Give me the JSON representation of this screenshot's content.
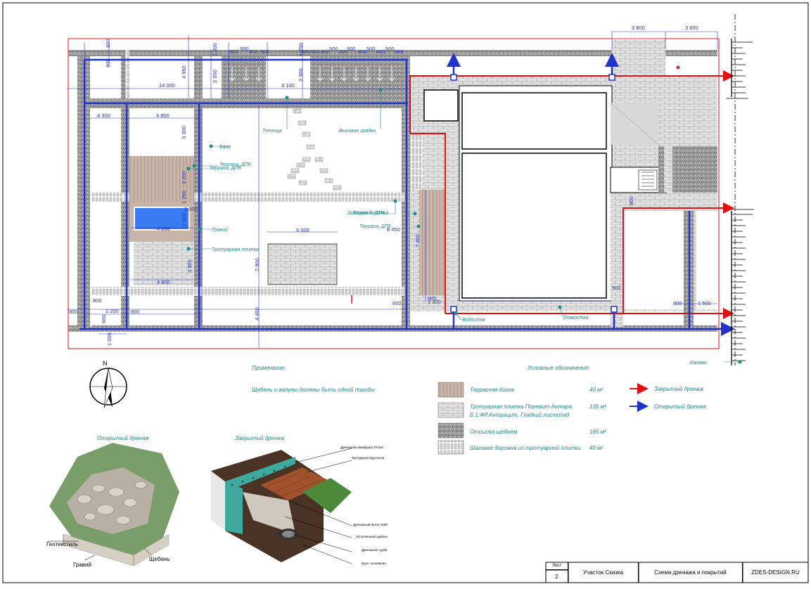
{
  "dims": {
    "top": [
      "3 800",
      "3 600",
      "800",
      "800",
      "500",
      "800",
      "500",
      "800",
      "800",
      "500",
      "800",
      "500",
      "800",
      "500",
      "800",
      "800",
      "500",
      "800",
      "800"
    ],
    "middle": [
      "14 000",
      "2 500",
      "3 100",
      "2 300",
      "4 950",
      "1 200",
      "1 250",
      "4 300",
      "4 800",
      "3 300",
      "3 200",
      "2 000",
      "1 200",
      "4 000",
      "2 000",
      "5 000",
      "2 800",
      "3 800",
      "4 800",
      "8 450",
      "7 400",
      "900",
      "800"
    ],
    "bottom": [
      "800",
      "800",
      "2 200",
      "600",
      "600",
      "1 000",
      "4 450",
      "600",
      "3 300",
      "900",
      "800",
      "1 500"
    ]
  },
  "labels": {
    "teplitsa": "Теплица",
    "vysokie_gryadki": "Высокие грядки",
    "bania": "Баня",
    "terrasa_dpk_1": "Терраса, ДПК",
    "terrasa_dpk_2": "Терраса, ДПК",
    "graviy": "Гравий",
    "trot_plitka": "Тротуарная плитка",
    "shagovaya": "Шаговая дорожка",
    "terrasa_dpk_3": "Терраса, ДПК",
    "terrasa_dpk_4": "Терраса, ДПК",
    "vodostok": "Водосток",
    "otmostka": "Отмостка",
    "kanava": "Канава"
  },
  "note": {
    "title": "Примечание:",
    "text": "Щебень и валуны должны быть одной породы"
  },
  "legend": {
    "title": "Условные обозначения:",
    "items": [
      {
        "name": "Террасная доска",
        "area": "40 м²"
      },
      {
        "name": "Тротуарная плитка Поревит Антара",
        "name2": "Б.1.ФР.Антрацит, Гладкий листопад",
        "area": "135 м²"
      },
      {
        "name": "Отсыпка щебнем",
        "area": "165 м²"
      },
      {
        "name": "Шаговая дорожка из тротуарной плитки",
        "area": "40 м²"
      }
    ],
    "closed": "Закрытый дренаж",
    "open": "Открытый дренаж"
  },
  "illustrations": {
    "open_title": "Открытый дренаж",
    "closed_title": "Закрытый дренаж",
    "open_labels": [
      "Геотекстиль",
      "Гравий",
      "Щебень"
    ],
    "closed_labels": [
      "Дренажная мембрана ТК Net",
      "Тротуарная брусчатка",
      "Дренажный бетон ПЭМ",
      "Уплотненный щебень",
      "Дренажная труба",
      "Грунт основания"
    ]
  },
  "compass": "N",
  "titleblock": {
    "sheet_label": "Лист",
    "sheet_no": "2",
    "project": "Участок Сказка",
    "drawing": "Схема дренажа и покрытий",
    "site": "ZDES-DESIGN.RU"
  },
  "colors": {
    "closed": "#e01010",
    "open": "#2233cc",
    "teal": "#1f8a8a"
  }
}
